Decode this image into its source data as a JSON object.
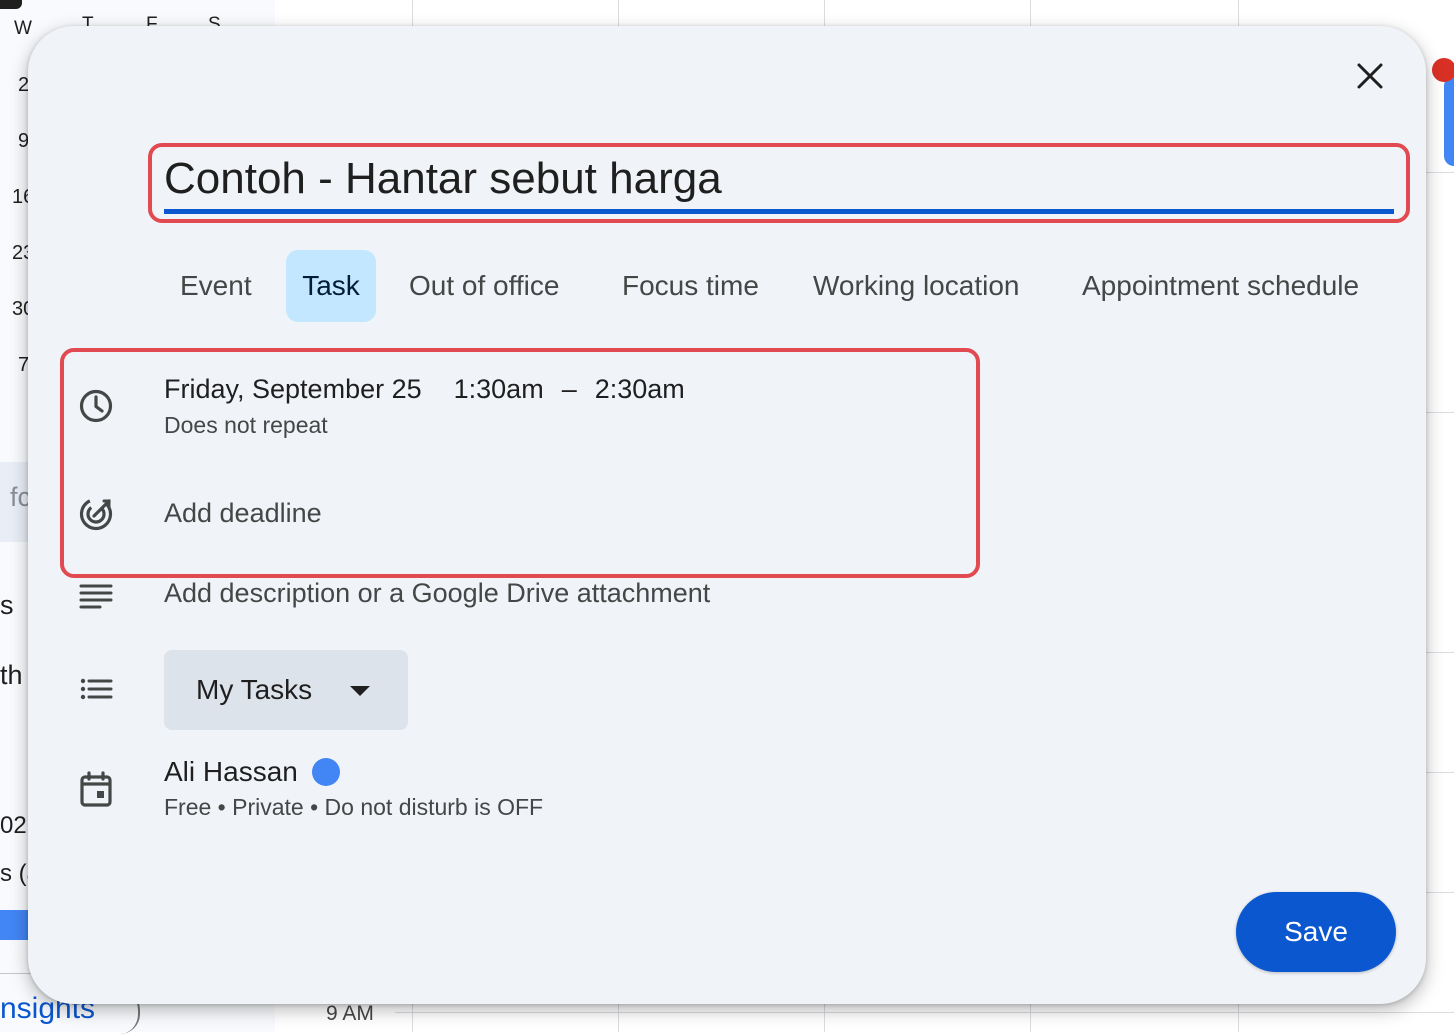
{
  "background": {
    "mini_calendar_headers": [
      "W",
      "T",
      "F",
      "S"
    ],
    "mini_calendar_dates": [
      "2",
      "9",
      "16",
      "23",
      "30",
      "7"
    ],
    "sidebar_fragments": [
      "fc",
      "s",
      "th",
      "02",
      "s (a"
    ],
    "insights_label": "nsights",
    "time_label": "9 AM"
  },
  "dialog": {
    "title_value": "Contoh - Hantar sebut harga",
    "tabs": [
      {
        "label": "Event",
        "active": false
      },
      {
        "label": "Task",
        "active": true
      },
      {
        "label": "Out of office",
        "active": false
      },
      {
        "label": "Focus time",
        "active": false
      },
      {
        "label": "Working location",
        "active": false
      },
      {
        "label": "Appointment schedule",
        "active": false
      }
    ],
    "date": "Friday, September 25",
    "start_time": "1:30am",
    "time_separator": "–",
    "end_time": "2:30am",
    "repeat": "Does not repeat",
    "add_deadline": "Add deadline",
    "description_placeholder": "Add description or a Google Drive attachment",
    "task_list": "My Tasks",
    "owner_name": "Ali Hassan",
    "owner_color": "#4285f4",
    "owner_details": "Free • Private • Do not disturb is OFF",
    "save_label": "Save"
  },
  "colors": {
    "primary": "#0b57d0",
    "active_tab": "#c2e7ff",
    "highlight_border": "#e04a50",
    "dialog_bg": "#f0f4f9"
  },
  "icons": [
    "close-icon",
    "clock-icon",
    "target-icon",
    "description-icon",
    "list-icon",
    "calendar-icon",
    "chevron-down-icon"
  ]
}
